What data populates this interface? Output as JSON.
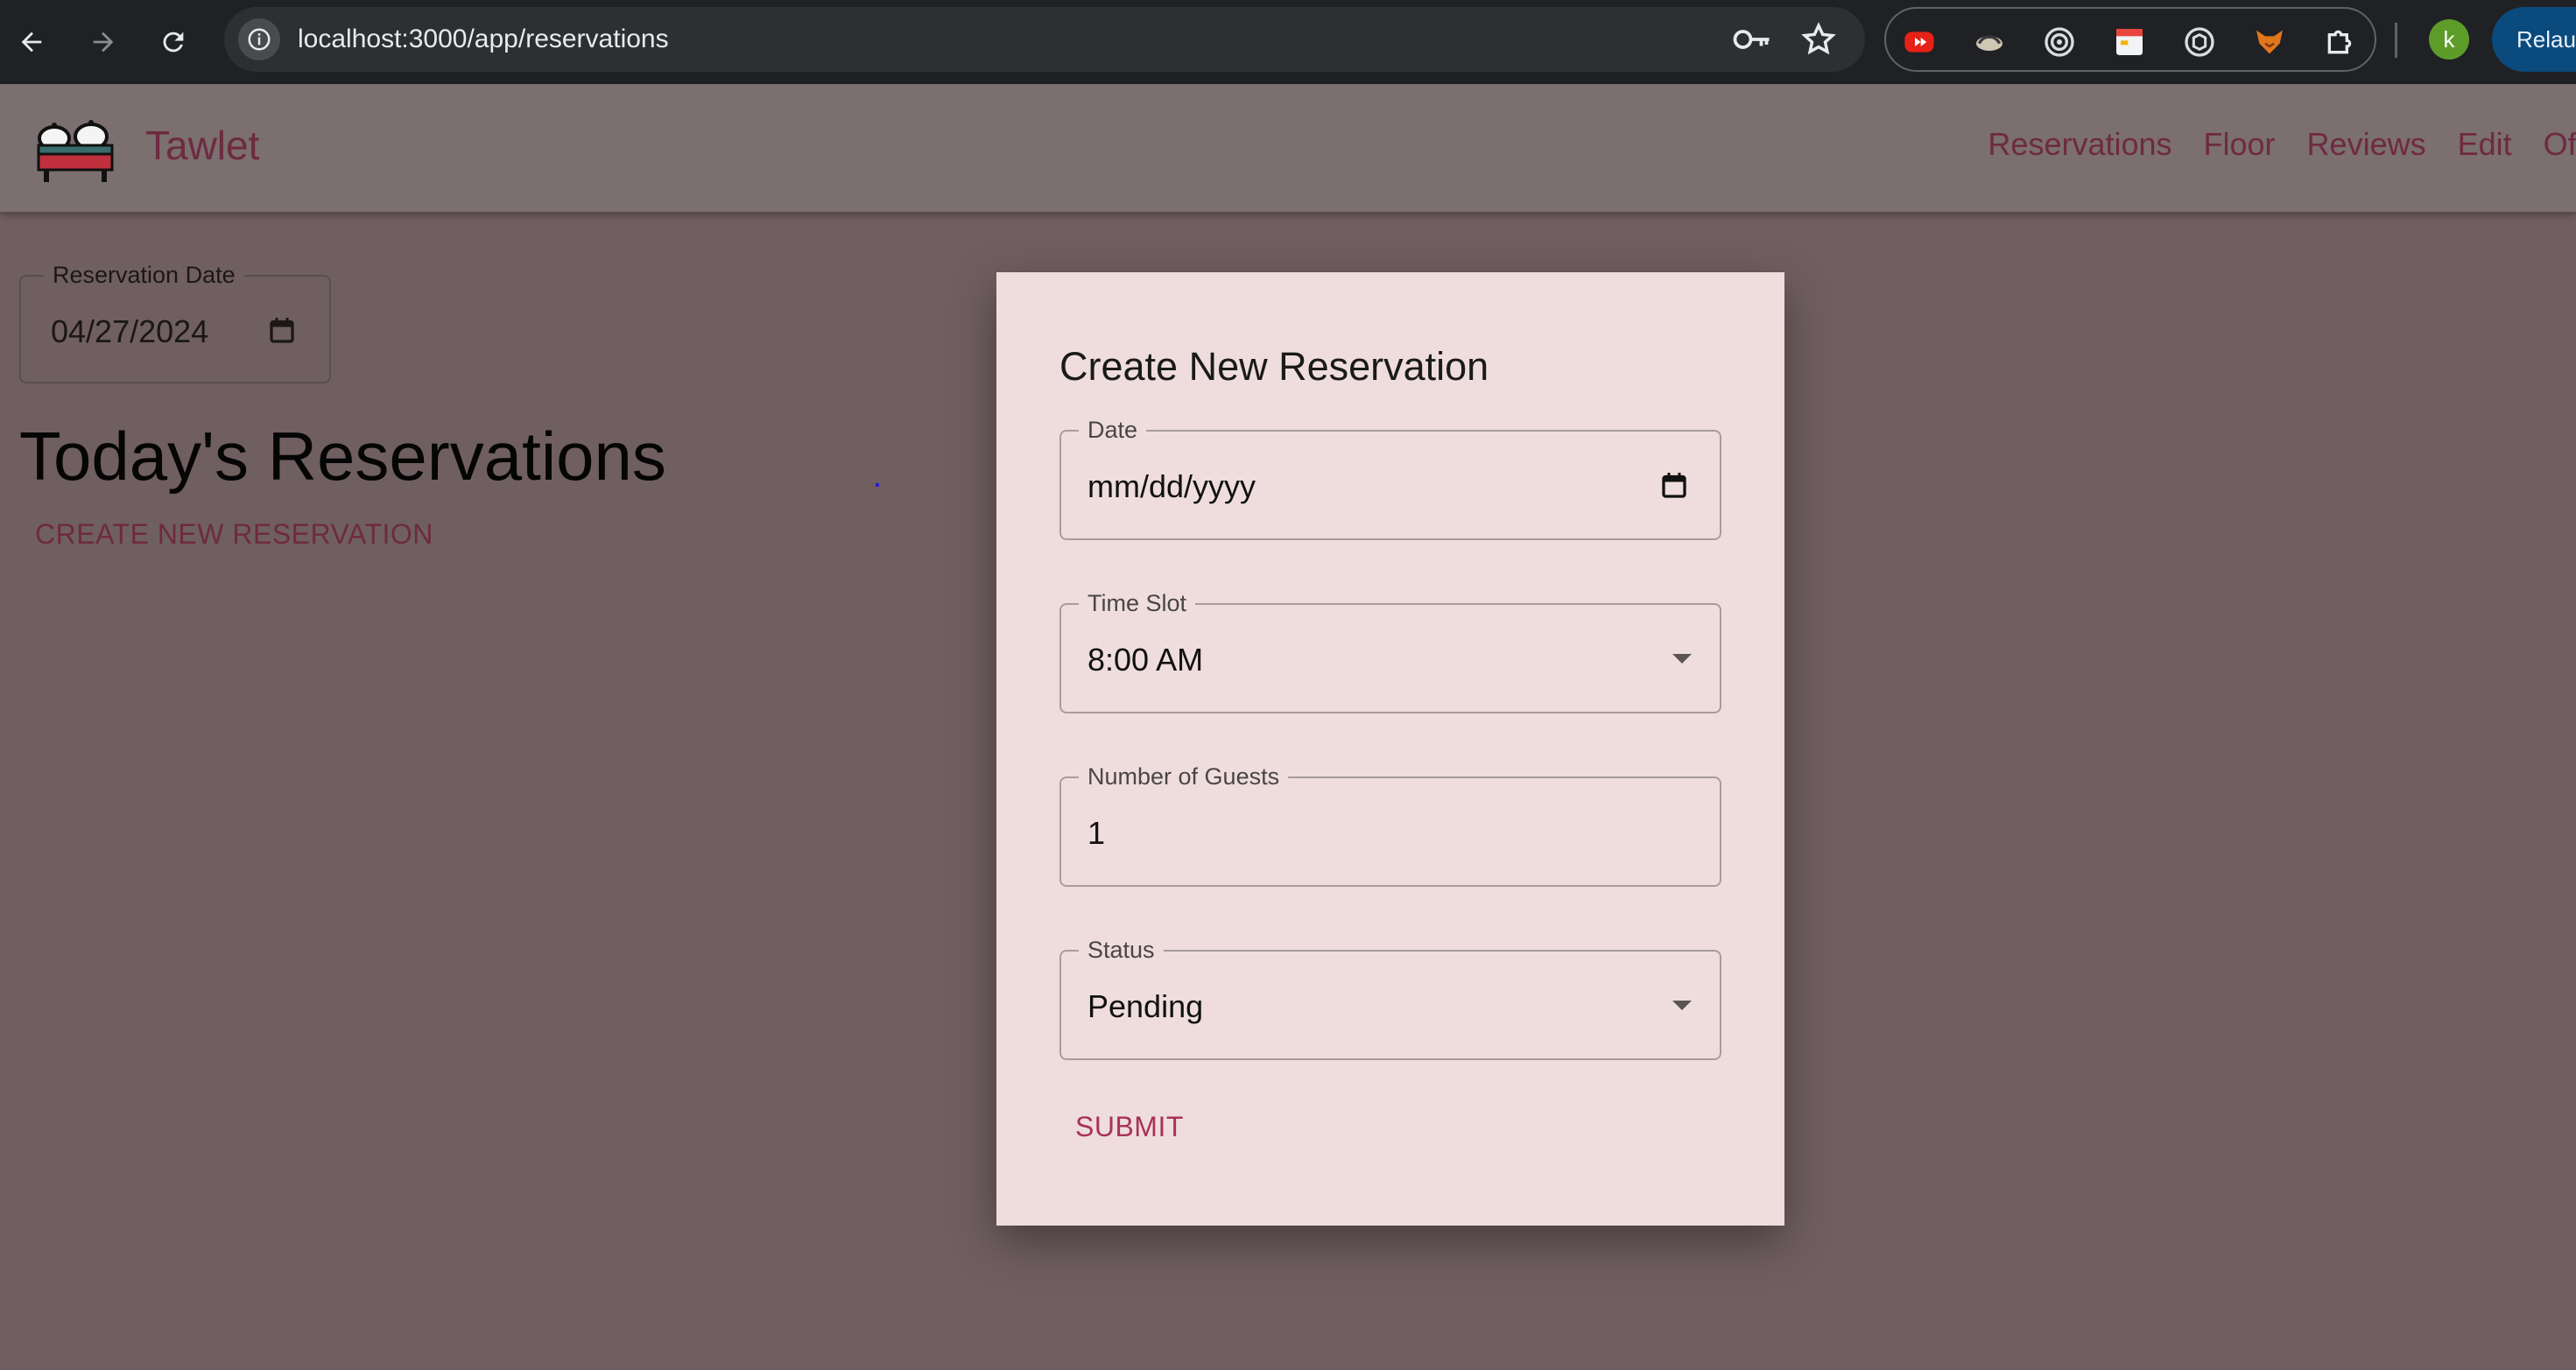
{
  "browser": {
    "url": "localhost:3000/app/reservations",
    "profile_initial": "k",
    "relaunch_label": "Relau"
  },
  "app": {
    "brand": "Tawlet",
    "nav": [
      "Reservations",
      "Floor",
      "Reviews",
      "Edit",
      "Off"
    ]
  },
  "page": {
    "date_label": "Reservation Date",
    "date_value": "04/27/2024",
    "heading": "Today's Reservations",
    "create_button": "CREATE NEW RESERVATION"
  },
  "modal": {
    "title": "Create New Reservation",
    "date": {
      "label": "Date",
      "placeholder": "mm/dd/yyyy"
    },
    "time_slot": {
      "label": "Time Slot",
      "value": "8:00 AM"
    },
    "guests": {
      "label": "Number of Guests",
      "value": "1"
    },
    "status": {
      "label": "Status",
      "value": "Pending"
    },
    "submit": "SUBMIT"
  },
  "colors": {
    "accent": "#6e2a42",
    "submit": "#a8325a",
    "modal_bg": "#efdddd",
    "backdrop": "#705f60"
  }
}
